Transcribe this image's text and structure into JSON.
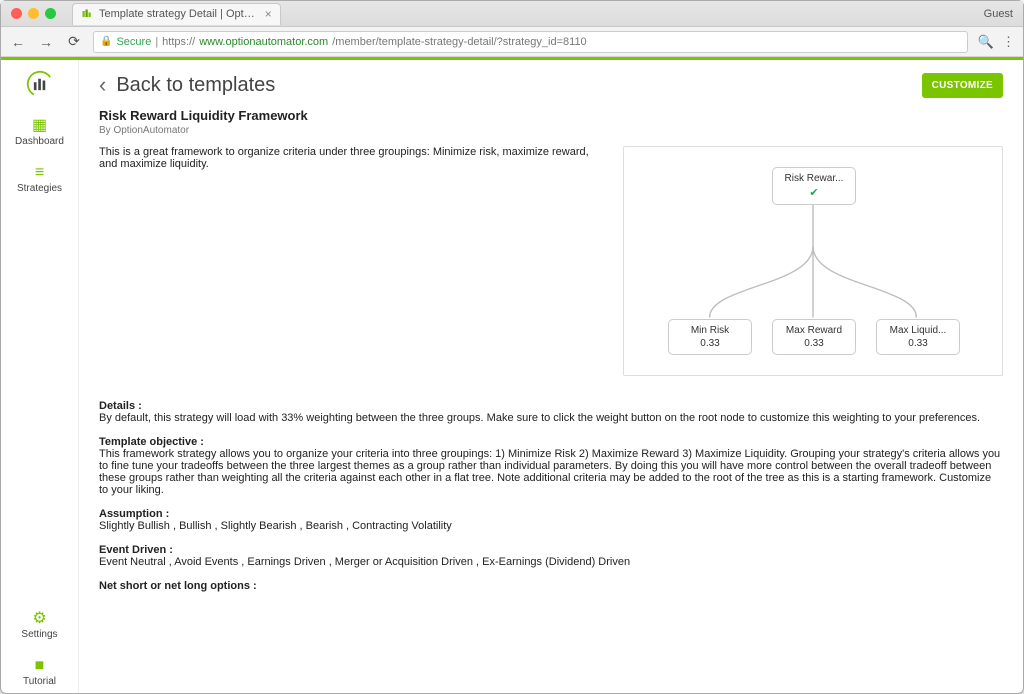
{
  "chrome": {
    "tab_title": "Template strategy Detail | Opt…",
    "guest_label": "Guest",
    "secure_label": "Secure",
    "url_scheme": "https://",
    "url_host": "www.optionautomator.com",
    "url_path": "/member/template-strategy-detail/?strategy_id=8110"
  },
  "sidebar": {
    "items": [
      {
        "icon": "dashboard",
        "label": "Dashboard"
      },
      {
        "icon": "list",
        "label": "Strategies"
      }
    ],
    "bottom": [
      {
        "icon": "gear",
        "label": "Settings"
      },
      {
        "icon": "video",
        "label": "Tutorial"
      }
    ]
  },
  "header": {
    "back_label": "Back to templates",
    "customize_label": "CUSTOMIZE"
  },
  "strategy": {
    "title": "Risk Reward Liquidity Framework",
    "byline": "By OptionAutomator",
    "description": "This is a great framework to organize criteria under three groupings: Minimize risk, maximize reward, and maximize liquidity."
  },
  "tree": {
    "root": {
      "label": "Risk Rewar..."
    },
    "children": [
      {
        "label": "Min Risk",
        "value": "0.33"
      },
      {
        "label": "Max Reward",
        "value": "0.33"
      },
      {
        "label": "Max Liquid...",
        "value": "0.33"
      }
    ]
  },
  "sections": {
    "details_label": "Details :",
    "details_text": "By default, this strategy will load with 33% weighting between the three groups.  Make sure to click the weight button on the root node to customize this weighting to your preferences.",
    "objective_label": "Template objective :",
    "objective_text": "This framework strategy allows you to organize your criteria into three groupings: 1) Minimize Risk 2) Maximize Reward 3) Maximize Liquidity. Grouping your strategy's criteria allows you to fine tune your tradeoffs between the three largest themes as a group rather than individual parameters. By doing this you will have more control between the overall tradeoff between these groups rather than weighting all the criteria against each other in a flat tree. Note additional criteria may be added to the root of the tree as this is a starting framework. Customize to your liking.",
    "assumption_label": "Assumption :",
    "assumption_text": "Slightly Bullish , Bullish , Slightly Bearish , Bearish , Contracting Volatility",
    "event_label": "Event Driven :",
    "event_text": "Event Neutral , Avoid Events , Earnings Driven , Merger or Acquisition Driven , Ex-Earnings (Dividend) Driven",
    "net_label": "Net short or net long options :"
  }
}
